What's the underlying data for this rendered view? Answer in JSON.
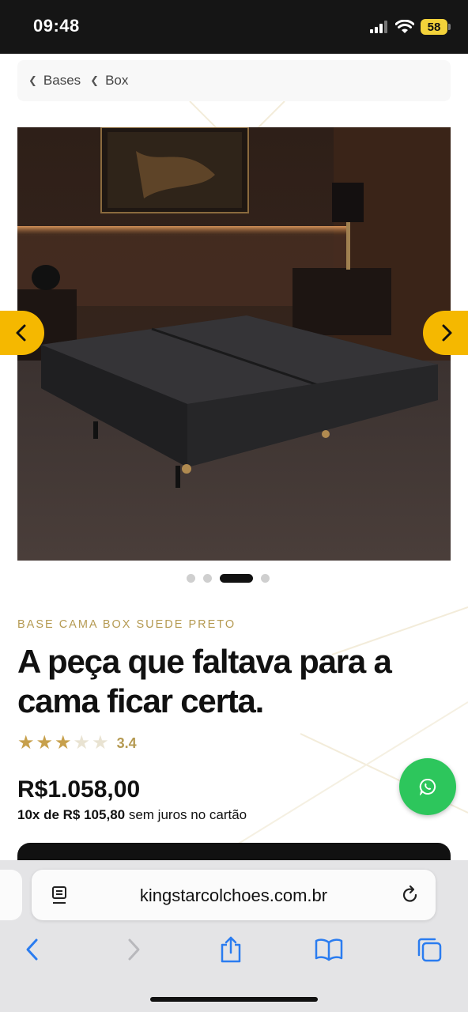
{
  "status_bar": {
    "time": "09:48",
    "battery": "58"
  },
  "breadcrumb": {
    "items": [
      {
        "label": "Bases"
      },
      {
        "label": "Box"
      }
    ]
  },
  "carousel": {
    "slide_count": 4,
    "active_index": 2
  },
  "product": {
    "kicker": "BASE CAMA BOX SUEDE PRETO",
    "title": "A peça que faltava para a cama ficar certa.",
    "rating": 3.4,
    "rating_label": "3.4",
    "price": "R$1.058,00",
    "installments_bold": "10x de R$ 105,80",
    "installments_rest": " sem juros no cartão"
  },
  "colors": {
    "accent_yellow": "#f5b800",
    "gold": "#b59a52",
    "whatsapp_green": "#2dc65c"
  },
  "browser": {
    "url": "kingstarcolchoes.com.br"
  },
  "icons": [
    "chevron-left-icon",
    "chevron-right-icon",
    "whatsapp-icon",
    "reader-icon",
    "reload-icon",
    "back-icon",
    "forward-icon",
    "share-icon",
    "bookmarks-icon",
    "tabs-icon"
  ]
}
